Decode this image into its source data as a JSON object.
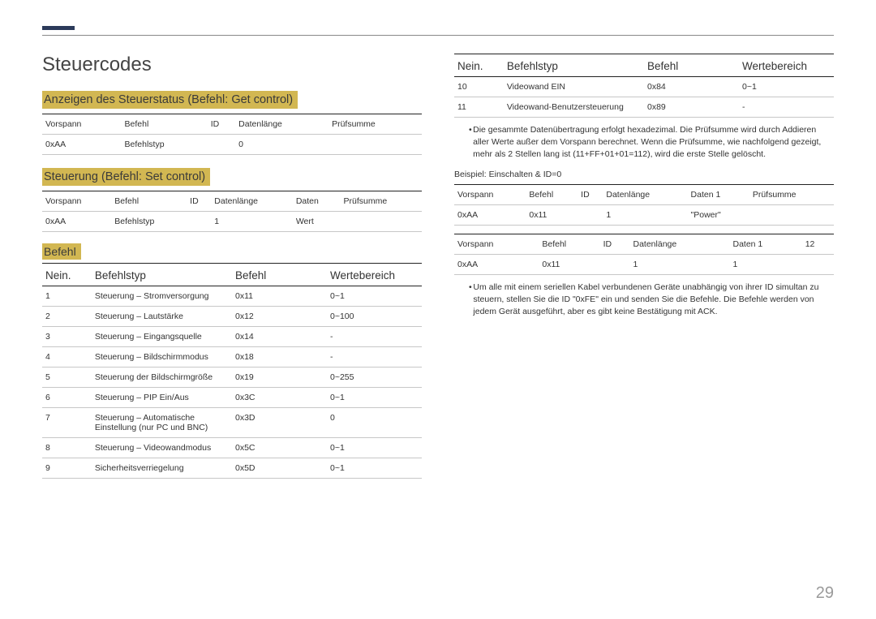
{
  "page_number": "29",
  "h1": "Steuercodes",
  "sections": {
    "get_control_title": "Anzeigen des Steuerstatus (Befehl: Get control)",
    "set_control_title": "Steuerung (Befehl: Set control)",
    "befehl_title": "Befehl"
  },
  "get_table": {
    "headers": [
      "Vorspann",
      "Befehl",
      "ID",
      "Datenlänge",
      "Prüfsumme"
    ],
    "row": [
      "0xAA",
      "Befehlstyp",
      "",
      "0",
      ""
    ]
  },
  "set_table": {
    "headers": [
      "Vorspann",
      "Befehl",
      "ID",
      "Datenlänge",
      "Daten",
      "Prüfsumme"
    ],
    "row": [
      "0xAA",
      "Befehlstyp",
      "",
      "1",
      "Wert",
      ""
    ]
  },
  "cmd_headers": [
    "Nein.",
    "Befehlstyp",
    "Befehl",
    "Wertebereich"
  ],
  "cmd_rows_left": [
    [
      "1",
      "Steuerung – Stromversorgung",
      "0x11",
      "0~1"
    ],
    [
      "2",
      "Steuerung – Lautstärke",
      "0x12",
      "0~100"
    ],
    [
      "3",
      "Steuerung – Eingangsquelle",
      "0x14",
      "-"
    ],
    [
      "4",
      "Steuerung – Bildschirmmodus",
      "0x18",
      "-"
    ],
    [
      "5",
      "Steuerung der Bildschirmgröße",
      "0x19",
      "0~255"
    ],
    [
      "6",
      "Steuerung – PIP Ein/Aus",
      "0x3C",
      "0~1"
    ],
    [
      "7",
      "Steuerung – Automatische Einstellung (nur PC und BNC)",
      "0x3D",
      "0"
    ],
    [
      "8",
      "Steuerung – Videowandmodus",
      "0x5C",
      "0~1"
    ],
    [
      "9",
      "Sicherheitsverriegelung",
      "0x5D",
      "0~1"
    ]
  ],
  "cmd_rows_right": [
    [
      "10",
      "Videowand EIN",
      "0x84",
      "0~1"
    ],
    [
      "11",
      "Videowand-Benutzersteuerung",
      "0x89",
      "-"
    ]
  ],
  "bullet1": "Die gesammte Datenübertragung erfolgt hexadezimal. Die Prüfsumme wird durch Addieren aller Werte außer dem Vorspann berechnet. Wenn die Prüfsumme, wie nachfolgend gezeigt, mehr als 2 Stellen lang ist (11+FF+01+01=112), wird die erste Stelle gelöscht.",
  "example_label": "Beispiel: Einschalten & ID=0",
  "ex_table1": {
    "headers": [
      "Vorspann",
      "Befehl",
      "ID",
      "Datenlänge",
      "Daten 1",
      "Prüfsumme"
    ],
    "row": [
      "0xAA",
      "0x11",
      "",
      "1",
      "\"Power\"",
      ""
    ]
  },
  "ex_table2": {
    "headers": [
      "Vorspann",
      "Befehl",
      "ID",
      "Datenlänge",
      "Daten 1",
      "12"
    ],
    "row": [
      "0xAA",
      "0x11",
      "",
      "1",
      "1",
      ""
    ]
  },
  "bullet2": "Um alle mit einem seriellen Kabel verbundenen Geräte unabhängig von ihrer ID simultan zu steuern, stellen Sie die ID \"0xFE\" ein und senden Sie die Befehle. Die Befehle werden von jedem Gerät ausgeführt, aber es gibt keine Bestätigung mit ACK."
}
